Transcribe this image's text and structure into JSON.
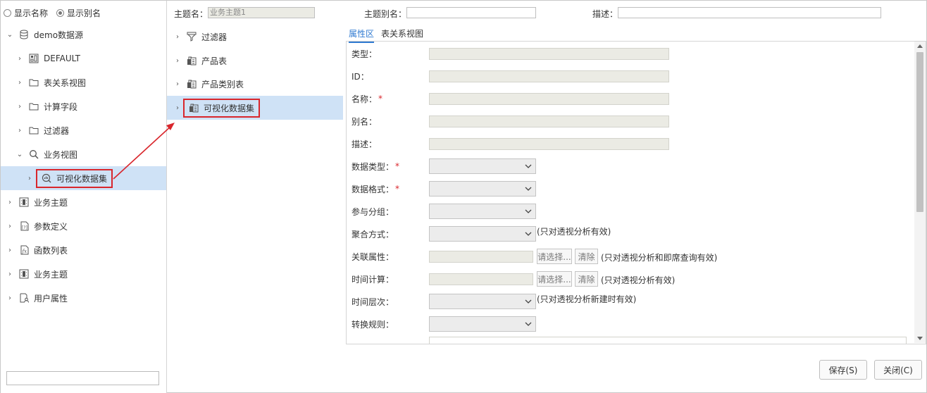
{
  "display_options": {
    "name_label": "显示名称",
    "alias_label": "显示别名",
    "selected": "alias"
  },
  "left_tree": [
    {
      "label": "demo数据源",
      "icon": "database-icon",
      "level": 0,
      "expanded": true
    },
    {
      "label": "DEFAULT",
      "icon": "schema-icon",
      "level": 1
    },
    {
      "label": "表关系视图",
      "icon": "folder-icon",
      "level": 1
    },
    {
      "label": "计算字段",
      "icon": "folder-icon",
      "level": 1
    },
    {
      "label": "过滤器",
      "icon": "folder-icon",
      "level": 1
    },
    {
      "label": "业务视图",
      "icon": "search-icon",
      "level": 1,
      "expanded": true
    },
    {
      "label": "可视化数据集",
      "icon": "visual-dataset-icon",
      "level": 2,
      "selected": true
    },
    {
      "label": "业务主题",
      "icon": "business-topic-icon",
      "level": 0
    },
    {
      "label": "参数定义",
      "icon": "parameter-icon",
      "level": 0
    },
    {
      "label": "函数列表",
      "icon": "function-icon",
      "level": 0
    },
    {
      "label": "业务主题",
      "icon": "business-topic-icon",
      "level": 0
    },
    {
      "label": "用户属性",
      "icon": "user-attribute-icon",
      "level": 0
    }
  ],
  "header": {
    "topic_name_label": "主题名：",
    "topic_name_value": "业务主题1",
    "topic_alias_label": "主题别名：",
    "topic_alias_value": "",
    "desc_label": "描述：",
    "desc_value": ""
  },
  "mid_tree": [
    {
      "label": "过滤器",
      "icon": "filter-icon"
    },
    {
      "label": "产品表",
      "icon": "table-icon"
    },
    {
      "label": "产品类别表",
      "icon": "table-icon"
    },
    {
      "label": "可视化数据集",
      "icon": "table-icon",
      "selected": true
    }
  ],
  "tabs": [
    {
      "label": "属性区",
      "active": true
    },
    {
      "label": "表关系视图",
      "active": false
    }
  ],
  "props": {
    "type_label": "类型：",
    "id_label": "ID：",
    "name_label": "名称：",
    "alias_label": "别名：",
    "desc_label": "描述：",
    "data_type_label": "数据类型：",
    "data_format_label": "数据格式：",
    "group_label": "参与分组：",
    "agg_label": "聚合方式：",
    "agg_note": "(只对透视分析有效)",
    "rel_label": "关联属性：",
    "rel_note": "(只对透视分析和即席查询有效)",
    "time_calc_label": "时间计算：",
    "time_calc_note": "(只对透视分析有效)",
    "time_level_label": "时间层次：",
    "time_level_note": "(只对透视分析新建时有效)",
    "convert_label": "转换规则：",
    "required_mark": "*",
    "choose_btn": "请选择...",
    "clear_btn": "清除"
  },
  "buttons": {
    "save": "保存(S)",
    "close": "关闭(C)"
  },
  "colors": {
    "selection_bg": "#cfe2f6",
    "highlight_red": "#d9262c",
    "tab_active": "#2f7ad1"
  }
}
